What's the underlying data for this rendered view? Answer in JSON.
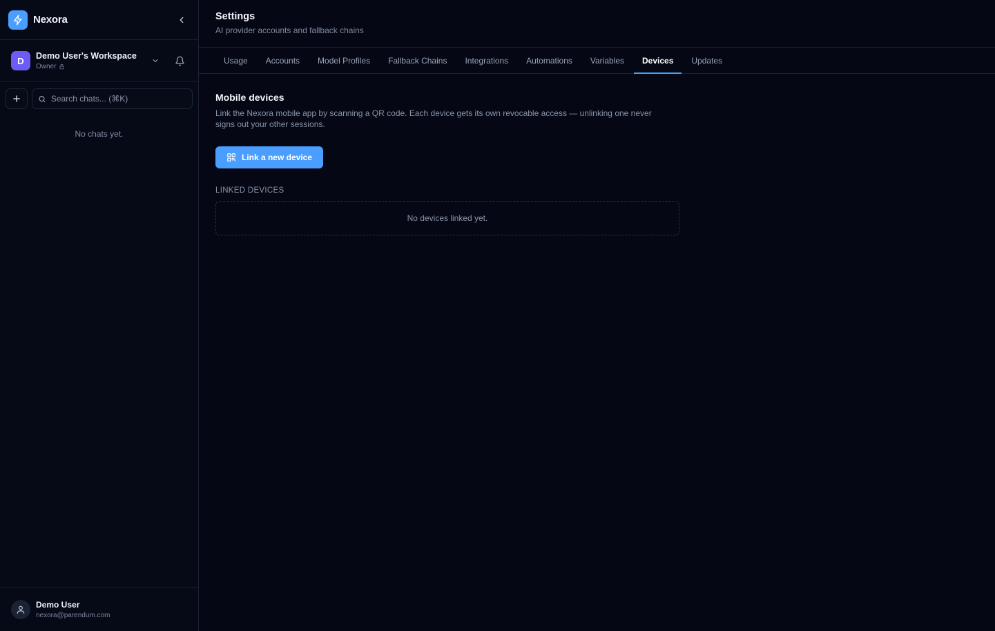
{
  "app": {
    "name": "Nexora"
  },
  "workspace": {
    "avatar_letter": "D",
    "name": "Demo User's Workspace",
    "role": "Owner"
  },
  "sidebar": {
    "search_placeholder": "Search chats... (⌘K)",
    "empty_chats": "No chats yet."
  },
  "user": {
    "name": "Demo User",
    "email": "nexora@parendum.com"
  },
  "header": {
    "title": "Settings",
    "subtitle": "AI provider accounts and fallback chains"
  },
  "tabs": [
    {
      "label": "Usage",
      "active": false
    },
    {
      "label": "Accounts",
      "active": false
    },
    {
      "label": "Model Profiles",
      "active": false
    },
    {
      "label": "Fallback Chains",
      "active": false
    },
    {
      "label": "Integrations",
      "active": false
    },
    {
      "label": "Automations",
      "active": false
    },
    {
      "label": "Variables",
      "active": false
    },
    {
      "label": "Devices",
      "active": true
    },
    {
      "label": "Updates",
      "active": false
    }
  ],
  "devices": {
    "title": "Mobile devices",
    "description": "Link the Nexora mobile app by scanning a QR code. Each device gets its own revocable access — unlinking one never signs out your other sessions.",
    "link_button": "Link a new device",
    "linked_label": "LINKED DEVICES",
    "empty": "No devices linked yet."
  },
  "colors": {
    "accent": "#4a9eff",
    "workspace_avatar": "#6b5cf6",
    "background": "#050814"
  }
}
